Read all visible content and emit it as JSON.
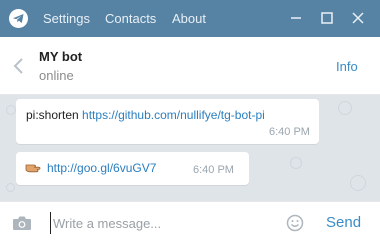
{
  "app": {
    "menu": {
      "settings": "Settings",
      "contacts": "Contacts",
      "about": "About"
    },
    "icons": [
      "telegram-logo",
      "minimize",
      "maximize",
      "close"
    ]
  },
  "header": {
    "title": "MY bot",
    "status": "online",
    "info_label": "Info"
  },
  "messages": [
    {
      "command": "pi:shorten",
      "link": "https://github.com/nullifye/tg-bot-pi",
      "time": "6:40 PM"
    },
    {
      "icon": "pointing-hand",
      "link": "http://goo.gl/6vuGV7",
      "time": "6:40 PM"
    }
  ],
  "composer": {
    "placeholder": "Write a message...",
    "send_label": "Send"
  },
  "colors": {
    "titlebar": "#5682a3",
    "chat_background": "#dfe4e9",
    "accent": "#3a8cc6",
    "link": "#2b7fbf"
  }
}
